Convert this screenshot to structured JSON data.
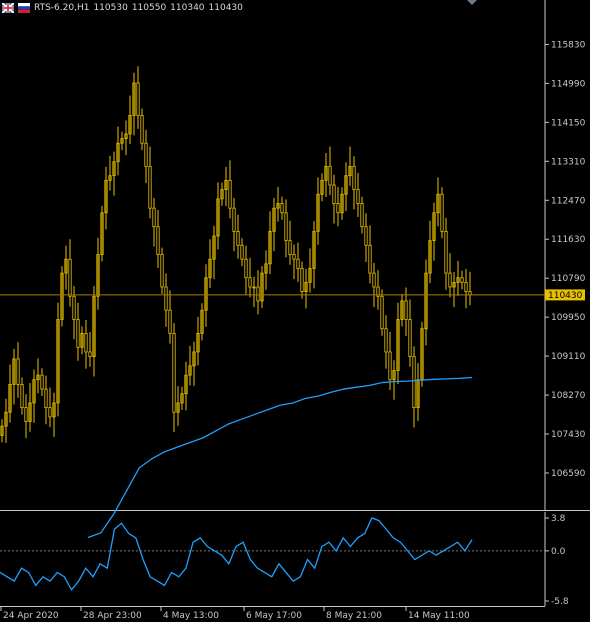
{
  "header": {
    "symbol_line": "RTS-6.20,H1",
    "ohlc": [
      "110530",
      "110550",
      "110340",
      "110430"
    ],
    "icons": [
      "uk-flag-icon",
      "ru-flag-icon"
    ]
  },
  "price_axis": {
    "ticks": [
      "115830",
      "114990",
      "114150",
      "113310",
      "112470",
      "111630",
      "110790",
      "109950",
      "109110",
      "108270",
      "107430",
      "106590"
    ],
    "current_price_label": "110430"
  },
  "indicator_axis": {
    "ticks": [
      "3.8",
      "0.0",
      "-5.8"
    ]
  },
  "time_axis": {
    "labels": [
      "24 Apr 2020",
      "28 Apr 23:00",
      "4 May 13:00",
      "6 May 17:00",
      "8 May 21:00",
      "14 May 11:00"
    ]
  },
  "colors": {
    "background": "#000000",
    "candle": "#e8c000",
    "ma_line": "#1ea0ff",
    "osc_line": "#1ea0ff",
    "price_line": "#a08000",
    "grid_text": "#c8c8c8",
    "price_label_bg": "#e8c000"
  },
  "chart_data": {
    "type": "line",
    "price_series_close": [
      107600,
      107900,
      108500,
      109050,
      108500,
      108000,
      107700,
      108100,
      108600,
      108700,
      108400,
      108000,
      107800,
      108100,
      109900,
      110900,
      111200,
      110400,
      109900,
      109300,
      109600,
      109200,
      109100,
      110400,
      111300,
      112200,
      112900,
      113000,
      113300,
      113700,
      113800,
      113900,
      114300,
      115000,
      114300,
      113700,
      113200,
      112300,
      111900,
      111300,
      110600,
      110100,
      109600,
      107900,
      108100,
      108300,
      108700,
      108900,
      109200,
      109600,
      110100,
      110800,
      111200,
      111700,
      112500,
      112700,
      112900,
      112300,
      111800,
      111500,
      111200,
      110800,
      110600,
      110600,
      110300,
      110900,
      111100,
      111800,
      112300,
      112400,
      112200,
      111600,
      111300,
      111200,
      111000,
      110500,
      110700,
      111000,
      111800,
      112600,
      112900,
      113200,
      112800,
      112400,
      112200,
      112600,
      113000,
      113200,
      112700,
      112400,
      111900,
      111500,
      110900,
      110600,
      110400,
      109700,
      109200,
      108600,
      108800,
      109900,
      110300,
      109900,
      109100,
      108000,
      108600,
      109700,
      110900,
      111600,
      112200,
      112600,
      111800,
      110900,
      110600,
      110700,
      110800,
      110700,
      110500,
      110430
    ],
    "moving_average": [
      105200,
      105300,
      105700,
      106200,
      106700,
      106900,
      107050,
      107150,
      107250,
      107350,
      107500,
      107650,
      107750,
      107850,
      107950,
      108050,
      108100,
      108200,
      108250,
      108330,
      108400,
      108440,
      108480,
      108540,
      108560,
      108570,
      108590,
      108610,
      108620,
      108630,
      108650
    ],
    "oscillator": [
      -2.5,
      -3.0,
      -3.5,
      -2.0,
      -2.5,
      -4.0,
      -3.0,
      -3.5,
      -2.5,
      -3.0,
      -4.5,
      -3.5,
      -2.0,
      -3.0,
      -1.5,
      -2.0,
      2.5,
      3.2,
      2.0,
      1.5,
      -1.0,
      -3.0,
      -3.5,
      -4.0,
      -2.5,
      -3.0,
      -2.0,
      1.0,
      1.5,
      0.5,
      0.0,
      -0.5,
      -1.5,
      0.5,
      1.0,
      -1.0,
      -2.0,
      -2.5,
      -3.0,
      -1.5,
      -2.5,
      -3.5,
      -3.0,
      -1.0,
      -2.0,
      0.5,
      1.0,
      0.0,
      1.5,
      0.5,
      1.5,
      2.0,
      3.8,
      3.5,
      2.5,
      1.5,
      1.0,
      0.0,
      -1.0,
      -0.5,
      0.0,
      -0.5,
      0.0,
      0.5,
      1.0,
      0.0,
      1.3
    ],
    "price_ylim": [
      105900,
      116400
    ],
    "osc_ylim": [
      -5.8,
      3.8
    ],
    "current_price": 110430,
    "grid": false
  }
}
